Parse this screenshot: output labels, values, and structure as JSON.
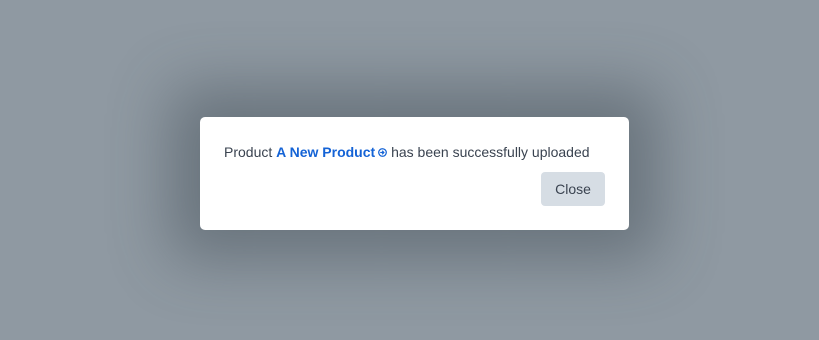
{
  "dialog": {
    "message_prefix": "Product ",
    "product_name": "A New Product",
    "message_suffix": " has been successfully uploaded",
    "close_label": "Close",
    "link_icon": "arrow-circle-right-icon",
    "accent_color": "#1463d6"
  }
}
